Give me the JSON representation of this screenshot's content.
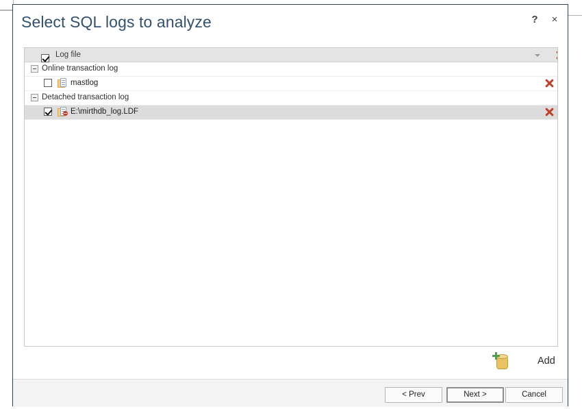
{
  "dialog": {
    "title": "Select SQL logs to analyze",
    "help_icon": "?",
    "close_icon": "×"
  },
  "list": {
    "header": {
      "label": "Log file",
      "checked": true,
      "filter_icon": "chevron-down-icon",
      "delete_icon": "red-x-icon"
    },
    "groups": [
      {
        "label": "Online transaction log",
        "expanded": true,
        "items": [
          {
            "label": "mastlog",
            "checked": false,
            "selected": false,
            "icon": "log-file-icon",
            "has_badge": false
          }
        ]
      },
      {
        "label": "Detached transaction log",
        "expanded": true,
        "items": [
          {
            "label": "E:\\mirthdb_log.LDF",
            "checked": true,
            "selected": true,
            "icon": "detached-log-file-icon",
            "has_badge": true
          }
        ]
      }
    ]
  },
  "add": {
    "label": "Add",
    "icon": "add-database-icon"
  },
  "footer": {
    "buttons": [
      {
        "label": "< Prev",
        "default": false
      },
      {
        "label": "Next >",
        "default": true
      },
      {
        "label": "Cancel",
        "default": false
      }
    ]
  },
  "colors": {
    "title": "#32516e",
    "dialog_border": "#2b4257",
    "header_band": "#e4e4e4",
    "selection": "#dcdcdc",
    "delete_red": "#c0402b",
    "add_green": "#4f9e4a",
    "add_gold": "#e9c263"
  }
}
